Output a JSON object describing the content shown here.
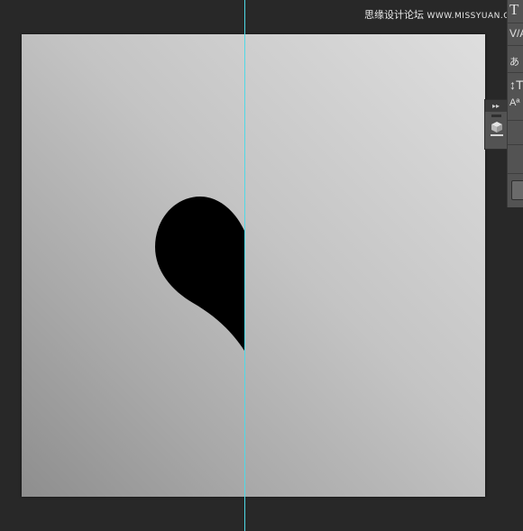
{
  "watermark": {
    "site_name": "思缘设计论坛",
    "url": "WWW.MISSYUAN.COM"
  },
  "colors": {
    "workspace_bg": "#282828",
    "guide": "#4fd9e6",
    "panel_bg": "#535353",
    "shape_fill": "#000000"
  },
  "character_panel": {
    "row1_label": "T",
    "row2_label": "V/A",
    "row3_label": "あ",
    "row4_label": "↕T",
    "row5_label": "Aª"
  },
  "dock": {
    "expand_label": "▸▸"
  },
  "icons": {
    "dock_icon": "3d-cube-icon",
    "heart_shape": "half-heart-shape"
  }
}
